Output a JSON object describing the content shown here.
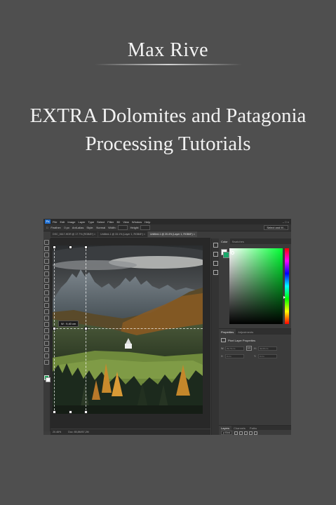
{
  "cover": {
    "author": "Max Rive",
    "title_line1": "EXTRA Dolomites and Patagonia",
    "title_line2": "Processing Tutorials"
  },
  "photoshop": {
    "app_logo": "Ps",
    "menu": [
      "File",
      "Edit",
      "Image",
      "Layer",
      "Type",
      "Select",
      "Filter",
      "3D",
      "View",
      "Window",
      "Help"
    ],
    "window_controls": "–  □  ×",
    "options": {
      "feather_label": "Feather:",
      "feather_value": "0 px",
      "antialias_label": "Anti-alias",
      "style_label": "Style:",
      "style_value": "Normal",
      "width_label": "Width:",
      "height_label": "Height:",
      "select_mask_button": "Select and M..."
    },
    "tabs": [
      {
        "label": "DSC_0617-HDR @ 17.7% (RGB/8*) ×",
        "active": false
      },
      {
        "label": "Untitled-1 @ 33.1% (Layer 1, RGB/8*) ×",
        "active": false
      },
      {
        "label": "Untitled-1 @ 20.4% (Layer 1, RGB/8*) ×",
        "active": true
      }
    ],
    "measure_tooltip": "W : 9,40 cm",
    "status": {
      "zoom": "20.46%",
      "doc": "Doc: 85,8M/57,2M"
    },
    "color_panel": {
      "tabs": [
        {
          "label": "Color",
          "active": true
        },
        {
          "label": "Swatches",
          "active": false
        }
      ]
    },
    "properties_panel": {
      "tabs": [
        {
          "label": "Properties",
          "active": true
        },
        {
          "label": "Adjustments",
          "active": false
        }
      ],
      "heading": "Pixel Layer Properties",
      "w_label": "W:",
      "w_value": "29,70 cm",
      "h_label": "H:",
      "h_value": "42,00 cm",
      "x_label": "X:",
      "x_value": "0 cm",
      "y_label": "Y:",
      "y_value": "0 cm",
      "link_glyph": "GO"
    },
    "layers_panel": {
      "tabs": [
        {
          "label": "Layers",
          "active": true
        },
        {
          "label": "Channels",
          "active": false
        },
        {
          "label": "Paths",
          "active": false
        }
      ],
      "kind_filter": "ρ Kind"
    },
    "colors": {
      "foreground": "#1fa65a",
      "picker_hue": "#00ff33"
    }
  }
}
